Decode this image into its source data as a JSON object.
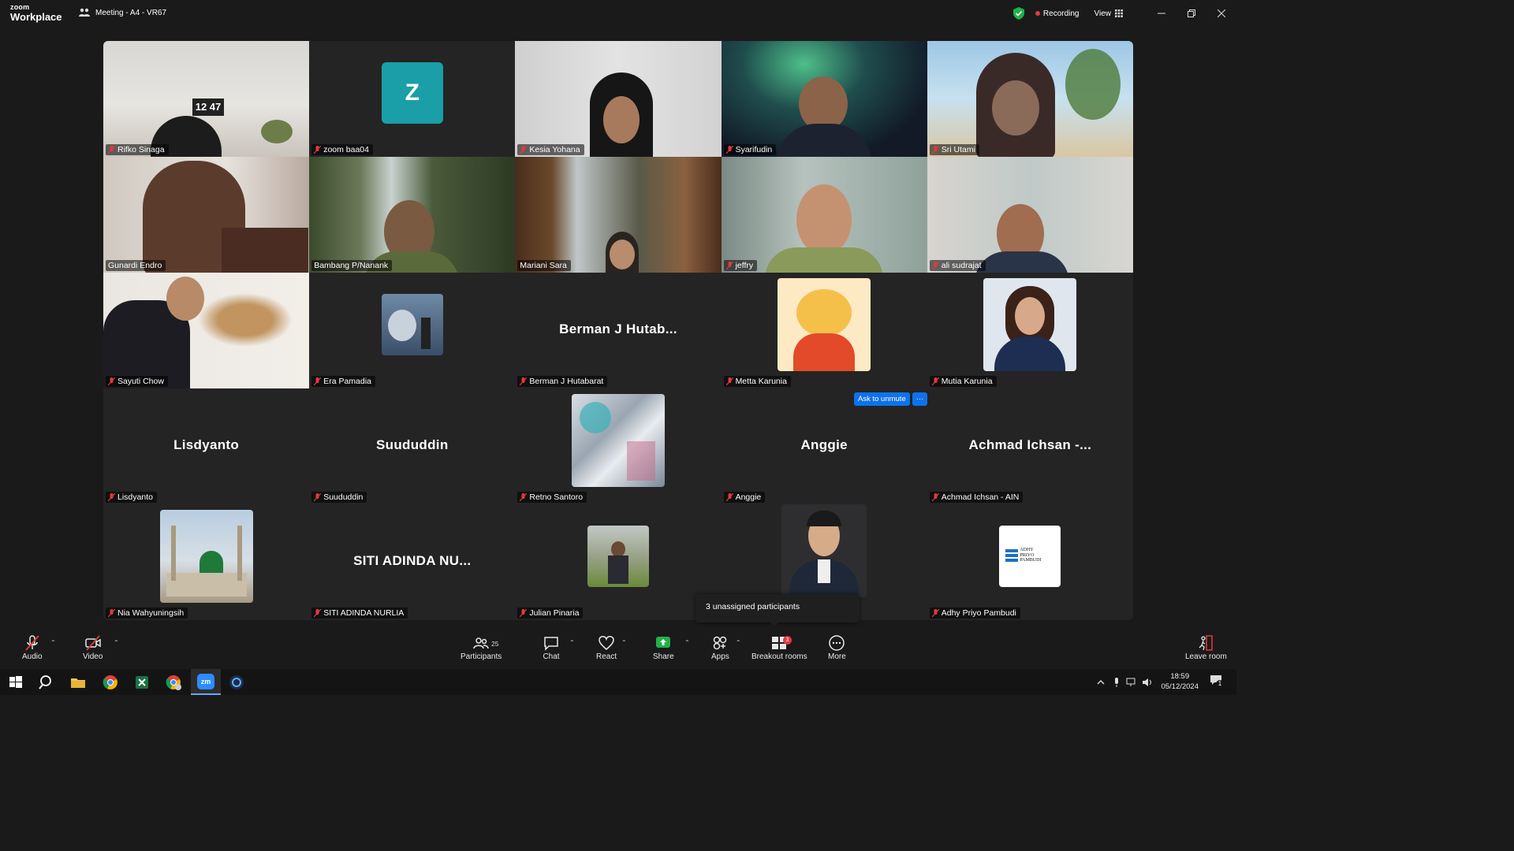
{
  "app": {
    "brand_top": "zoom",
    "brand_bottom": "Workplace",
    "meeting_title": "Meeting - A4 - VR67",
    "recording_label": "Recording",
    "view_label": "View"
  },
  "tiles": [
    {
      "name": "Rifko Sinaga",
      "kind": "video",
      "muted": true
    },
    {
      "name": "zoom baa04",
      "kind": "initial",
      "initial": "Z",
      "muted": true
    },
    {
      "name": "Kesia Yohana",
      "kind": "video",
      "muted": true
    },
    {
      "name": "Syarifudin",
      "kind": "video",
      "muted": true
    },
    {
      "name": "Sri Utami",
      "kind": "video",
      "muted": true
    },
    {
      "name": "Gunardi Endro",
      "kind": "video",
      "muted": false
    },
    {
      "name": "Bambang P/Nanank",
      "kind": "video",
      "muted": false
    },
    {
      "name": "Mariani Sara",
      "kind": "video",
      "muted": false,
      "active": true
    },
    {
      "name": "jeffry",
      "kind": "video",
      "muted": true
    },
    {
      "name": "ali sudrajat",
      "kind": "video",
      "muted": true
    },
    {
      "name": "Sayuti Chow",
      "kind": "video",
      "muted": true
    },
    {
      "name": "Era Pamadia",
      "kind": "photo",
      "muted": true
    },
    {
      "name": "Berman J Hutabarat",
      "kind": "text",
      "display": "Berman J Hutab...",
      "muted": true
    },
    {
      "name": "Metta Karunia",
      "kind": "photo",
      "muted": true
    },
    {
      "name": "Mutia Karunia",
      "kind": "photo",
      "muted": true
    },
    {
      "name": "Lisdyanto",
      "kind": "text",
      "display": "Lisdyanto",
      "muted": true
    },
    {
      "name": "Suududdin",
      "kind": "text",
      "display": "Suududdin",
      "muted": true
    },
    {
      "name": "Retno Santoro",
      "kind": "photo",
      "muted": true
    },
    {
      "name": "Anggie",
      "kind": "text",
      "display": "Anggie",
      "muted": true
    },
    {
      "name": "Achmad Ichsan - AIN",
      "kind": "text",
      "display": "Achmad Ichsan -...",
      "muted": true
    },
    {
      "name": "Nia Wahyuningsih",
      "kind": "photo",
      "muted": true
    },
    {
      "name": "SITI ADINDA NURLIA",
      "kind": "text",
      "display": "SITI ADINDA NU...",
      "muted": true
    },
    {
      "name": "Julian Pinaria",
      "kind": "photo",
      "muted": true
    },
    {
      "name": "",
      "kind": "photo",
      "muted": false
    },
    {
      "name": "Adhy Priyo Pambudi",
      "kind": "photo",
      "muted": true
    }
  ],
  "ask_unmute": {
    "label": "Ask to unmute",
    "more": "···"
  },
  "unassigned_popup": "3 unassigned participants",
  "toolbar": {
    "audio": "Audio",
    "video": "Video",
    "participants": "Participants",
    "participants_count": "25",
    "chat": "Chat",
    "react": "React",
    "share": "Share",
    "apps": "Apps",
    "breakout": "Breakout rooms",
    "breakout_badge": "3",
    "more": "More",
    "leave": "Leave room"
  },
  "taskbar": {
    "time": "18:59",
    "date": "05/12/2024",
    "notif": "1"
  },
  "colors": {
    "accent_green": "#1fc48a",
    "zoom_blue": "#0e72ed",
    "recording_red": "#e5383b",
    "avatar_teal": "#1a9ea8"
  }
}
